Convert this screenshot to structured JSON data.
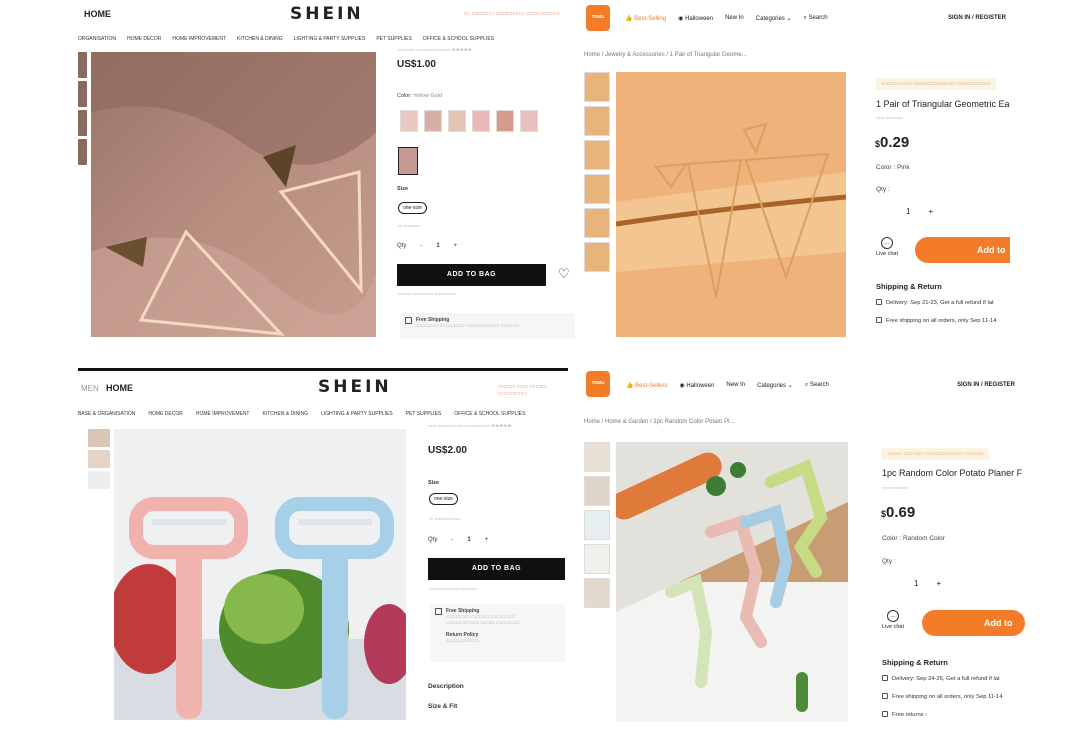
{
  "tl": {
    "nav_home": "HOME",
    "logo": "SHEIN",
    "categories": [
      "ORGANISATION",
      "HOME DECOR",
      "HOME IMPROVEMENT",
      "KITCHEN & DINING",
      "LIGHTING & PARTY SUPPLIES",
      "PET SUPPLIES",
      "OFFICE & SCHOOL SUPPLIES"
    ],
    "price": "US$1.00",
    "color_label": "Color:",
    "color_value": "Yellow Gold",
    "size_label": "Size",
    "size_value": "one-size",
    "qty_label": "Qty",
    "qty_value": "1",
    "qty_minus": "-",
    "qty_plus": "+",
    "add_to_bag": "ADD TO BAG",
    "shipping_title": "Free Shipping"
  },
  "tr": {
    "logo": "TEMU",
    "nav": [
      "Best-Selling",
      "Halloween",
      "New In",
      "Categories"
    ],
    "search": "Search",
    "sign_in": "SIGN IN / REGISTER",
    "breadcrumb": "Home  /  Jewelry & Accessories  /  1 Pair of Triangular Geome...",
    "title": "1 Pair of Triangular Geometric Ear",
    "price_symbol": "$",
    "price": "0.29",
    "color_label": "Color :",
    "color_value": "Pink",
    "qty_label": "Qty :",
    "qty_value": "1",
    "qty_plus": "+",
    "live_chat": "Live chat",
    "add_to_cart": "Add to",
    "shipping_heading": "Shipping & Return",
    "delivery": "Delivery: Sep 21-23, Get a full refund if lat",
    "free_shipping": "Free shipping on all orders, only Sep 11-14"
  },
  "bl": {
    "nav_men": "MEN",
    "nav_home": "HOME",
    "logo": "SHEIN",
    "categories": [
      "BASE & ORGANISATION",
      "HOME DECOR",
      "HOME IMPROVEMENT",
      "KITCHEN & DINING",
      "LIGHTING & PARTY SUPPLIES",
      "PET SUPPLIES",
      "OFFICE & SCHOOL SUPPLIES"
    ],
    "price": "US$2.00",
    "size_label": "Size",
    "size_value": "one-size",
    "qty_label": "Qty",
    "qty_value": "1",
    "qty_minus": "-",
    "qty_plus": "+",
    "add_to_bag": "ADD TO BAG",
    "free_shipping": "Free Shipping",
    "return_policy": "Return Policy",
    "description": "Description",
    "size_fit": "Size & Fit"
  },
  "br": {
    "logo": "TEMU",
    "nav": [
      "Best-Sellers",
      "Halloween",
      "New In",
      "Categories"
    ],
    "search": "Search",
    "sign_in": "SIGN IN / REGISTER",
    "breadcrumb": "Home  /  Home & Garden  /  1pc Random Color Potato Pl...",
    "title": "1pc Random Color Potato Planer F",
    "price_symbol": "$",
    "price": "0.69",
    "color_label": "Color :",
    "color_value": "Random Color",
    "qty_label": "Qty :",
    "qty_value": "1",
    "qty_plus": "+",
    "live_chat": "Live chat",
    "add_to_cart": "Add to",
    "shipping_heading": "Shipping & Return",
    "delivery": "Delivery: Sep 24-26, Get a full refund if lat",
    "free_shipping": "Free shipping on all orders, only Sep 11-14",
    "free_returns": "Free returns"
  },
  "colors": {
    "temu_orange": "#f47c28",
    "shein_black": "#111111",
    "shein_promo": "#e07a6a"
  }
}
